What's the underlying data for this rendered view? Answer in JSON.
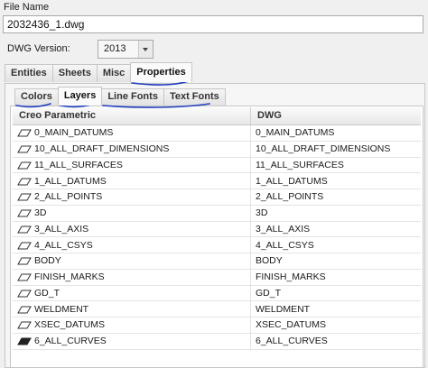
{
  "file": {
    "label": "File Name",
    "value": "2032436_1.dwg"
  },
  "dwg_version": {
    "label": "DWG Version:",
    "selected": "2013"
  },
  "main_tabs": [
    {
      "label": "Entities",
      "active": false
    },
    {
      "label": "Sheets",
      "active": false
    },
    {
      "label": "Misc",
      "active": false
    },
    {
      "label": "Properties",
      "active": true
    }
  ],
  "sub_tabs": [
    {
      "label": "Colors",
      "active": false
    },
    {
      "label": "Layers",
      "active": true
    },
    {
      "label": "Line Fonts",
      "active": false
    },
    {
      "label": "Text Fonts",
      "active": false
    }
  ],
  "table": {
    "columns": [
      "Creo Parametric",
      "DWG"
    ],
    "rows": [
      {
        "creo": "0_MAIN_DATUMS",
        "dwg": "0_MAIN_DATUMS",
        "icon": "layer-icon"
      },
      {
        "creo": "10_ALL_DRAFT_DIMENSIONS",
        "dwg": "10_ALL_DRAFT_DIMENSIONS",
        "icon": "layer-icon"
      },
      {
        "creo": "11_ALL_SURFACES",
        "dwg": "11_ALL_SURFACES",
        "icon": "layer-icon"
      },
      {
        "creo": "1_ALL_DATUMS",
        "dwg": "1_ALL_DATUMS",
        "icon": "layer-icon"
      },
      {
        "creo": "2_ALL_POINTS",
        "dwg": "2_ALL_POINTS",
        "icon": "layer-icon"
      },
      {
        "creo": "3D",
        "dwg": "3D",
        "icon": "layer-icon"
      },
      {
        "creo": "3_ALL_AXIS",
        "dwg": "3_ALL_AXIS",
        "icon": "layer-icon"
      },
      {
        "creo": "4_ALL_CSYS",
        "dwg": "4_ALL_CSYS",
        "icon": "layer-icon"
      },
      {
        "creo": "BODY",
        "dwg": "BODY",
        "icon": "layer-icon"
      },
      {
        "creo": "FINISH_MARKS",
        "dwg": "FINISH_MARKS",
        "icon": "layer-icon"
      },
      {
        "creo": "GD_T",
        "dwg": "GD_T",
        "icon": "layer-icon"
      },
      {
        "creo": "WELDMENT",
        "dwg": "WELDMENT",
        "icon": "layer-icon"
      },
      {
        "creo": "XSEC_DATUMS",
        "dwg": "XSEC_DATUMS",
        "icon": "layer-icon"
      },
      {
        "creo": "6_ALL_CURVES",
        "dwg": "6_ALL_CURVES",
        "icon": "layer-filled-icon"
      }
    ]
  },
  "colors": {
    "annotation_ink": "#1f3fbf",
    "panel_border": "#c6c6c6"
  }
}
